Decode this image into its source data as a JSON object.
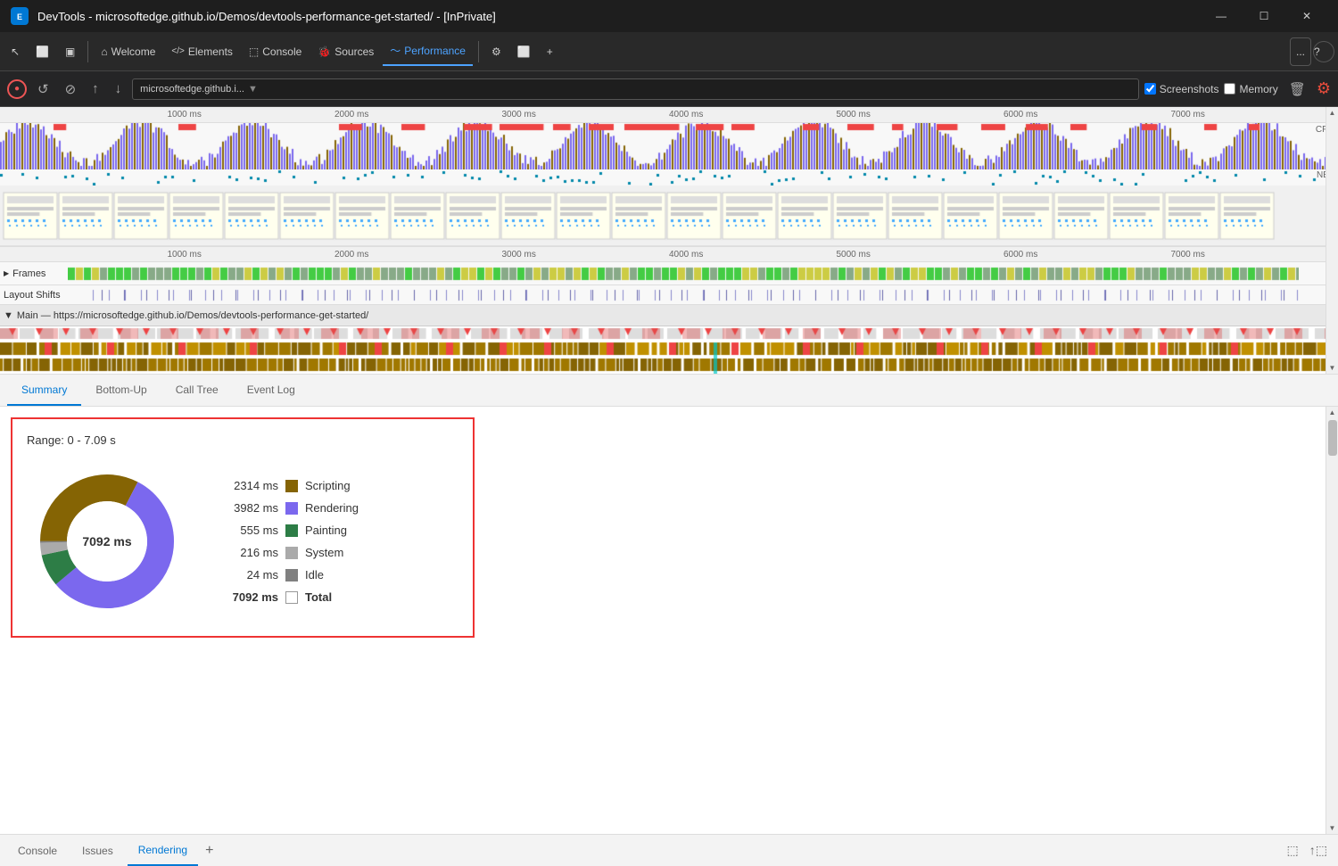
{
  "window": {
    "title": "DevTools - microsoftedge.github.io/Demos/devtools-performance-get-started/ - [InPrivate]",
    "controls": {
      "minimize": "—",
      "maximize": "☐",
      "close": "✕"
    }
  },
  "toolbar": {
    "tabs": [
      {
        "id": "welcome",
        "label": "Welcome",
        "icon": "⌂",
        "active": false
      },
      {
        "id": "elements",
        "label": "Elements",
        "icon": "</>",
        "active": false
      },
      {
        "id": "console",
        "label": "Console",
        "icon": "⬚",
        "active": false
      },
      {
        "id": "sources",
        "label": "Sources",
        "icon": "🐛",
        "active": false
      },
      {
        "id": "performance",
        "label": "Performance",
        "icon": "〜",
        "active": true
      }
    ],
    "extra_btn": "...",
    "help_btn": "?"
  },
  "record_bar": {
    "url": "microsoftedge.github.i...",
    "screenshots_checked": true,
    "screenshots_label": "Screenshots",
    "memory_checked": false,
    "memory_label": "Memory"
  },
  "timeline": {
    "ruler_ticks": [
      "1000 ms",
      "2000 ms",
      "3000 ms",
      "4000 ms",
      "5000 ms",
      "6000 ms",
      "7000 ms"
    ],
    "cpu_label": "CPU",
    "net_label": "NET",
    "main_url": "Main — https://microsoftedge.github.io/Demos/devtools-performance-get-started/",
    "frames_label": "Frames",
    "layout_shifts_label": "Layout Shifts"
  },
  "tabs": {
    "items": [
      {
        "id": "summary",
        "label": "Summary",
        "active": true
      },
      {
        "id": "bottom-up",
        "label": "Bottom-Up",
        "active": false
      },
      {
        "id": "call-tree",
        "label": "Call Tree",
        "active": false
      },
      {
        "id": "event-log",
        "label": "Event Log",
        "active": false
      }
    ]
  },
  "summary": {
    "range": "Range: 0 - 7.09 s",
    "total_ms_display": "7092 ms",
    "items": [
      {
        "ms": "2314 ms",
        "color": "#856404",
        "label": "Scripting"
      },
      {
        "ms": "3982 ms",
        "color": "#7b68ee",
        "label": "Rendering"
      },
      {
        "ms": "555 ms",
        "color": "#2d7d46",
        "label": "Painting"
      },
      {
        "ms": "216 ms",
        "color": "#aaaaaa",
        "label": "System"
      },
      {
        "ms": "24 ms",
        "color": "#808080",
        "label": "Idle"
      },
      {
        "ms": "7092 ms",
        "color": "white",
        "label": "Total",
        "is_total": true
      }
    ],
    "donut": {
      "scripting_pct": 32.6,
      "rendering_pct": 56.2,
      "painting_pct": 7.8,
      "system_pct": 3.0,
      "idle_pct": 0.4
    }
  },
  "dock_tabs": [
    {
      "label": "Console",
      "active": false
    },
    {
      "label": "Issues",
      "active": false
    },
    {
      "label": "Rendering",
      "active": true
    }
  ]
}
